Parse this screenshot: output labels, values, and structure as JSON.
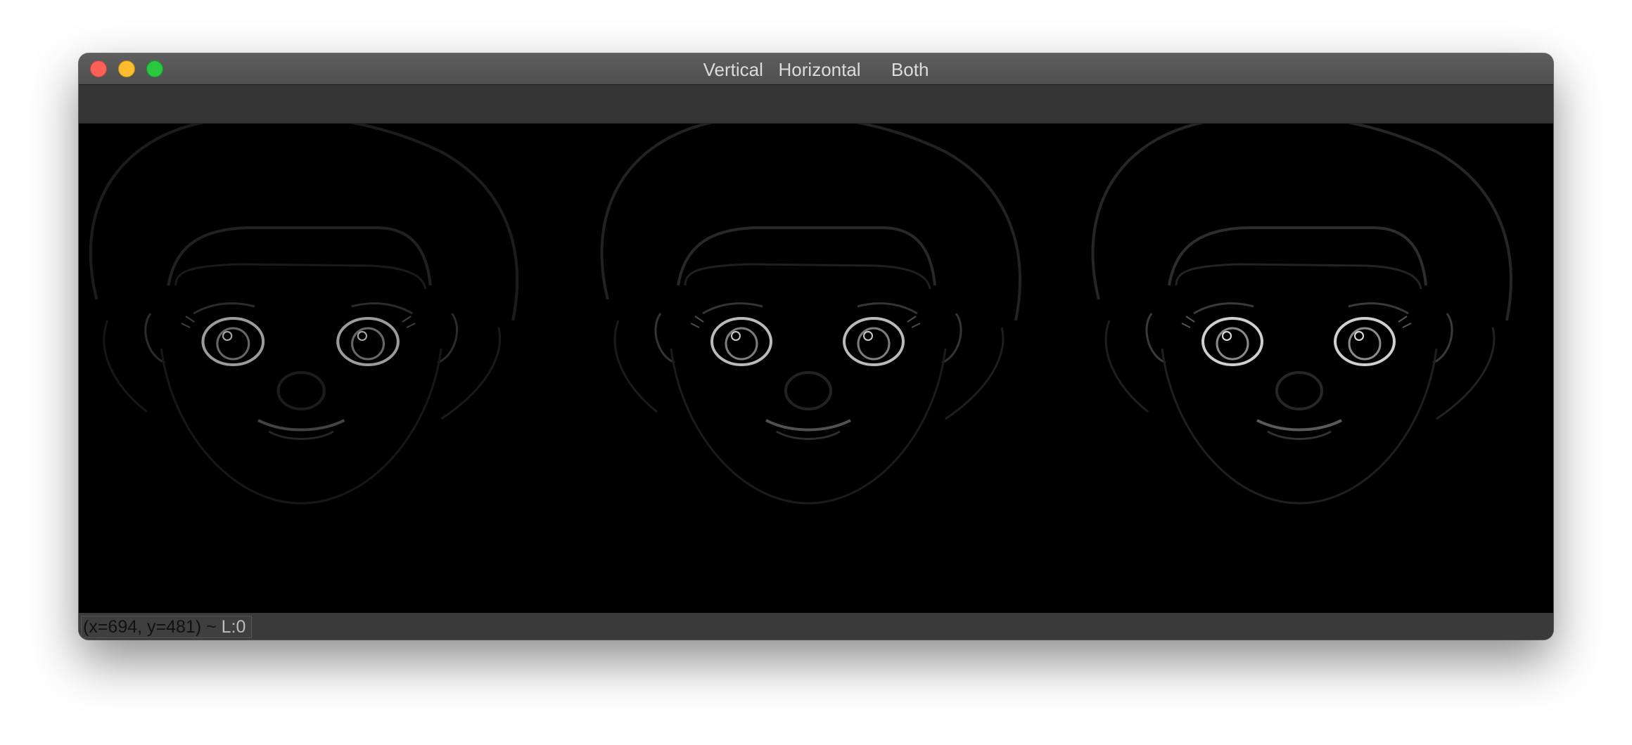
{
  "window": {
    "title": "Vertical   Horizontal      Both"
  },
  "panels": [
    {
      "label": "Vertical",
      "icon": "edge-map-vertical"
    },
    {
      "label": "Horizontal",
      "icon": "edge-map-horizontal"
    },
    {
      "label": "Both",
      "icon": "edge-map-both"
    }
  ],
  "status": {
    "coords": "(x=694, y=481) ~ ",
    "level": "L:0"
  },
  "colors": {
    "titlebar": "#555555",
    "toolbar": "#353535",
    "canvas": "#000000",
    "statusbar": "#3a3a3a",
    "close": "#fe5f57",
    "minimize": "#febc2e",
    "maximize": "#28c840"
  }
}
